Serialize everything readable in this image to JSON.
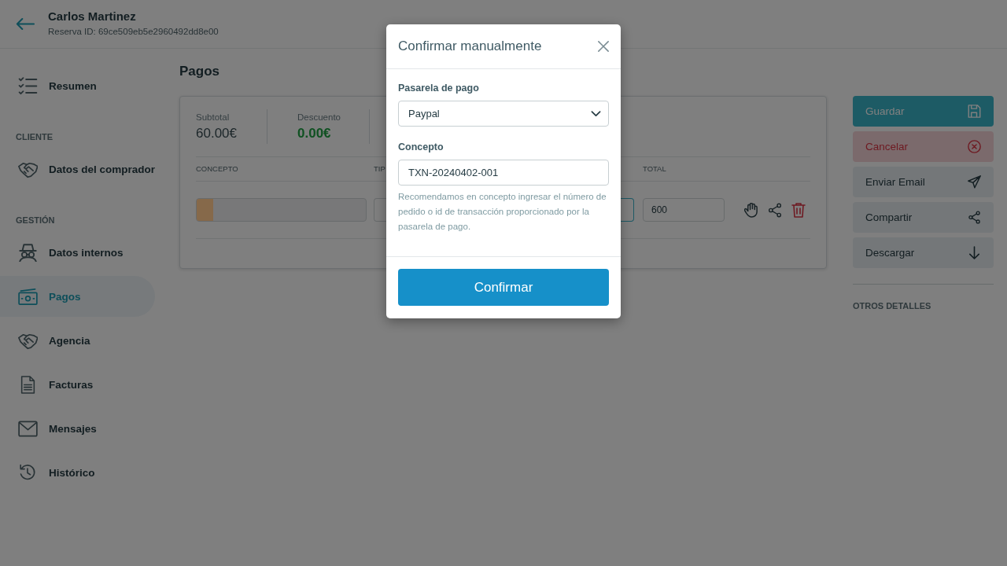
{
  "header": {
    "title": "Carlos Martinez",
    "subtitle": "Reserva ID: 69ce509eb5e2960492dd8e00"
  },
  "sidebar": {
    "groups": [
      {
        "items": [
          {
            "label": "Resumen",
            "selected": false
          }
        ]
      },
      {
        "heading": "CLIENTE",
        "items": [
          {
            "label": "Datos del comprador",
            "selected": false
          }
        ]
      },
      {
        "heading": "GESTIÓN",
        "items": [
          {
            "label": "Datos internos",
            "selected": false
          },
          {
            "label": "Pagos",
            "selected": true
          },
          {
            "label": "Agencia",
            "selected": false
          },
          {
            "label": "Facturas",
            "selected": false
          },
          {
            "label": "Mensajes",
            "selected": false
          },
          {
            "label": "Histórico",
            "selected": false
          }
        ]
      }
    ]
  },
  "page": {
    "title": "Pagos"
  },
  "summary": [
    {
      "label": "Subtotal",
      "value": "60.00€",
      "kind": "plain"
    },
    {
      "label": "Descuento",
      "value": "0.00€",
      "kind": "discount"
    }
  ],
  "table": {
    "columns": [
      "CONCEPTO",
      "TIP",
      "TOTAL"
    ],
    "rows": [
      {
        "color": "#86694a",
        "amount_focused": true,
        "total": "600"
      }
    ]
  },
  "actions": [
    {
      "label": "Guardar",
      "kind": "primary"
    },
    {
      "label": "Cancelar",
      "kind": "danger"
    },
    {
      "label": "Enviar Email",
      "kind": "plain"
    },
    {
      "label": "Compartir",
      "kind": "plain"
    },
    {
      "label": "Descargar",
      "kind": "plain"
    }
  ],
  "details": {
    "heading": "OTROS DETALLES"
  },
  "modal": {
    "title": "Confirmar manualmente",
    "fields": [
      {
        "kind": "select",
        "label": "Pasarela de pago",
        "value": "Paypal"
      },
      {
        "kind": "text",
        "label": "Concepto",
        "value": "TXN-20240402-001",
        "help": "Recomendamos en concepto ingresar el número de pedido o id de transacción proporcionado por la pasarela de pago."
      }
    ],
    "confirm": "Confirmar"
  }
}
